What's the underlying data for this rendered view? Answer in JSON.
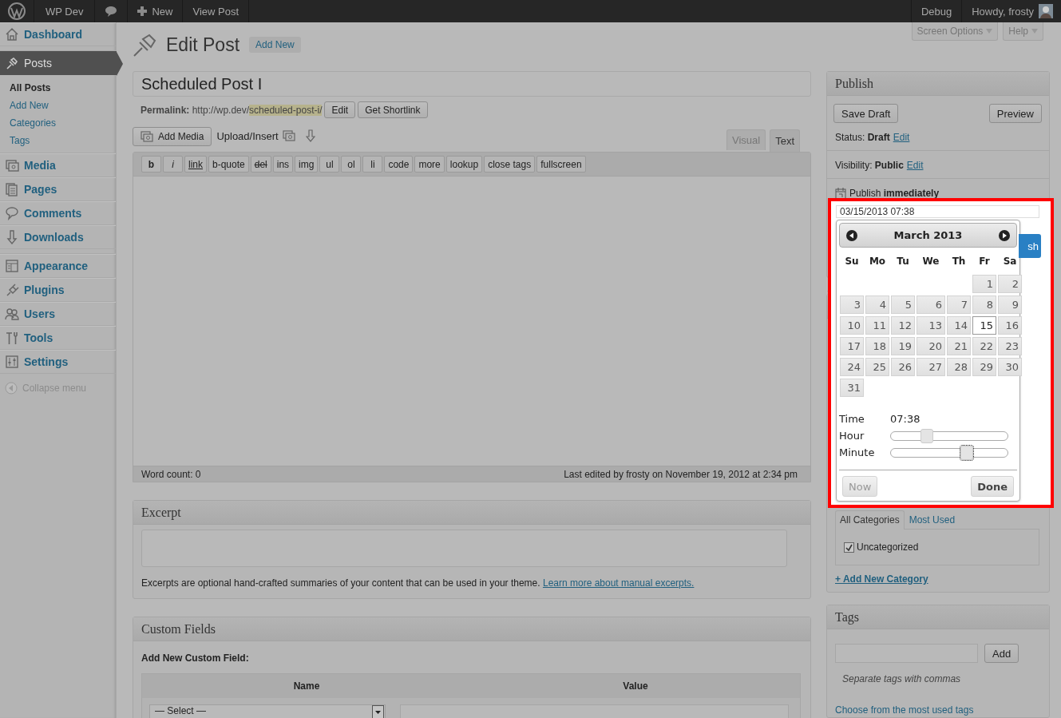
{
  "admin_bar": {
    "site": "WP Dev",
    "new": "New",
    "view_post": "View Post",
    "debug": "Debug",
    "greeting": "Howdy, frosty"
  },
  "screen_meta": [
    "Screen Options",
    "Help"
  ],
  "sidebar": {
    "items": [
      {
        "kind": "item",
        "label": "Dashboard",
        "selected": false
      },
      {
        "kind": "separator"
      },
      {
        "kind": "item",
        "label": "Posts",
        "selected": true,
        "children": [
          {
            "label": "All Posts",
            "selected": true
          },
          {
            "label": "Add New",
            "selected": false
          },
          {
            "label": "Categories",
            "selected": false
          },
          {
            "label": "Tags",
            "selected": false
          }
        ]
      },
      {
        "kind": "item",
        "label": "Media",
        "selected": false
      },
      {
        "kind": "item",
        "label": "Pages",
        "selected": false
      },
      {
        "kind": "item",
        "label": "Comments",
        "selected": false
      },
      {
        "kind": "item",
        "label": "Downloads",
        "selected": false
      },
      {
        "kind": "separator"
      },
      {
        "kind": "item",
        "label": "Appearance",
        "selected": false
      },
      {
        "kind": "item",
        "label": "Plugins",
        "selected": false
      },
      {
        "kind": "item",
        "label": "Users",
        "selected": false
      },
      {
        "kind": "item",
        "label": "Tools",
        "selected": false
      },
      {
        "kind": "item",
        "label": "Settings",
        "selected": false
      }
    ],
    "collapse": "Collapse menu"
  },
  "page": {
    "title": "Edit Post",
    "add_new": "Add New"
  },
  "post": {
    "title": "Scheduled Post I",
    "permalink": "**Permalink:** http://wp.dev/",
    "slug": "scheduled-post-i/",
    "edit": "Edit",
    "shortlink": "Get Shortlink"
  },
  "editor": {
    "add_media": "Add Media",
    "upload_insert": "Upload/Insert",
    "tabs": [
      {
        "label": "Visual",
        "selected": false
      },
      {
        "label": "Text",
        "selected": true
      }
    ],
    "quicktags": [
      {
        "label": "b",
        "kind": "bold"
      },
      {
        "label": "i",
        "kind": "italic"
      },
      {
        "label": "link",
        "kind": "link"
      },
      {
        "label": "b-quote",
        "kind": "plain"
      },
      {
        "label": "del",
        "kind": "strike"
      },
      {
        "label": "ins",
        "kind": "plain"
      },
      {
        "label": "img",
        "kind": "plain"
      },
      {
        "label": "ul",
        "kind": "plain"
      },
      {
        "label": "ol",
        "kind": "plain"
      },
      {
        "label": "li",
        "kind": "plain"
      },
      {
        "label": "code",
        "kind": "plain"
      },
      {
        "label": "more",
        "kind": "plain"
      },
      {
        "label": "lookup",
        "kind": "plain"
      },
      {
        "label": "close tags",
        "kind": "plain"
      },
      {
        "label": "fullscreen",
        "kind": "plain"
      }
    ],
    "word_count": "Word count: 0",
    "last_edited": "Last edited by frosty on November 19, 2012 at 2:34 pm"
  },
  "excerpt": {
    "title": "Excerpt",
    "help": "Excerpts are optional hand-crafted summaries of your content that can be used in your theme.",
    "link": "Learn more about manual excerpts."
  },
  "custom_fields": {
    "title": "Custom Fields",
    "subtitle": "Add New Custom Field:",
    "columns": [
      "Name",
      "Value"
    ],
    "select": "— Select —"
  },
  "publish": {
    "title": "Publish",
    "save_draft": "Save Draft",
    "preview": "Preview",
    "status": "Status: **Draft**",
    "status_edit": "Edit",
    "visibility": "Visibility: **Public**",
    "visibility_edit": "Edit",
    "schedule": "Publish **immediately**",
    "publish_button": "sh"
  },
  "datepicker": {
    "value": "03/15/2013 07:38",
    "month": "March 2013",
    "weekdays": [
      "Su",
      "Mo",
      "Tu",
      "We",
      "Th",
      "Fr",
      "Sa"
    ],
    "weeks": [
      [
        {
          "kind": "blank"
        },
        {
          "kind": "blank"
        },
        {
          "kind": "blank"
        },
        {
          "kind": "blank"
        },
        {
          "kind": "blank"
        },
        {
          "day": "1",
          "selected": false
        },
        {
          "day": "2",
          "selected": false
        }
      ],
      [
        {
          "day": "3",
          "selected": false
        },
        {
          "day": "4",
          "selected": false
        },
        {
          "day": "5",
          "selected": false
        },
        {
          "day": "6",
          "selected": false
        },
        {
          "day": "7",
          "selected": false
        },
        {
          "day": "8",
          "selected": false
        },
        {
          "day": "9",
          "selected": false
        }
      ],
      [
        {
          "day": "10",
          "selected": false
        },
        {
          "day": "11",
          "selected": false
        },
        {
          "day": "12",
          "selected": false
        },
        {
          "day": "13",
          "selected": false
        },
        {
          "day": "14",
          "selected": false
        },
        {
          "day": "15",
          "selected": true
        },
        {
          "day": "16",
          "selected": false
        }
      ],
      [
        {
          "day": "17",
          "selected": false
        },
        {
          "day": "18",
          "selected": false
        },
        {
          "day": "19",
          "selected": false
        },
        {
          "day": "20",
          "selected": false
        },
        {
          "day": "21",
          "selected": false
        },
        {
          "day": "22",
          "selected": false
        },
        {
          "day": "23",
          "selected": false
        }
      ],
      [
        {
          "day": "24",
          "selected": false
        },
        {
          "day": "25",
          "selected": false
        },
        {
          "day": "26",
          "selected": false
        },
        {
          "day": "27",
          "selected": false
        },
        {
          "day": "28",
          "selected": false
        },
        {
          "day": "29",
          "selected": false
        },
        {
          "day": "30",
          "selected": false
        }
      ],
      [
        {
          "day": "31",
          "selected": false
        },
        {
          "kind": "blank"
        },
        {
          "kind": "blank"
        },
        {
          "kind": "blank"
        },
        {
          "kind": "blank"
        },
        {
          "kind": "blank"
        },
        {
          "kind": "blank"
        }
      ]
    ],
    "time_label": "Time",
    "time": "07:38",
    "sliders": [
      {
        "label": "Hour",
        "level": 0.31,
        "focused": false
      },
      {
        "label": "Minute",
        "level": 0.65,
        "focused": true
      }
    ],
    "now": "Now",
    "now_disabled": true,
    "done": "Done"
  },
  "categories": {
    "tabs": [
      {
        "label": "All Categories",
        "selected": true
      },
      {
        "label": "Most Used",
        "selected": false
      }
    ],
    "items": [
      {
        "label": "Uncategorized",
        "checked": true
      }
    ],
    "add_new": "+ Add New Category"
  },
  "tags": {
    "title": "Tags",
    "add": "Add",
    "hint": "Separate tags with commas",
    "choose": "Choose from the most used tags"
  }
}
